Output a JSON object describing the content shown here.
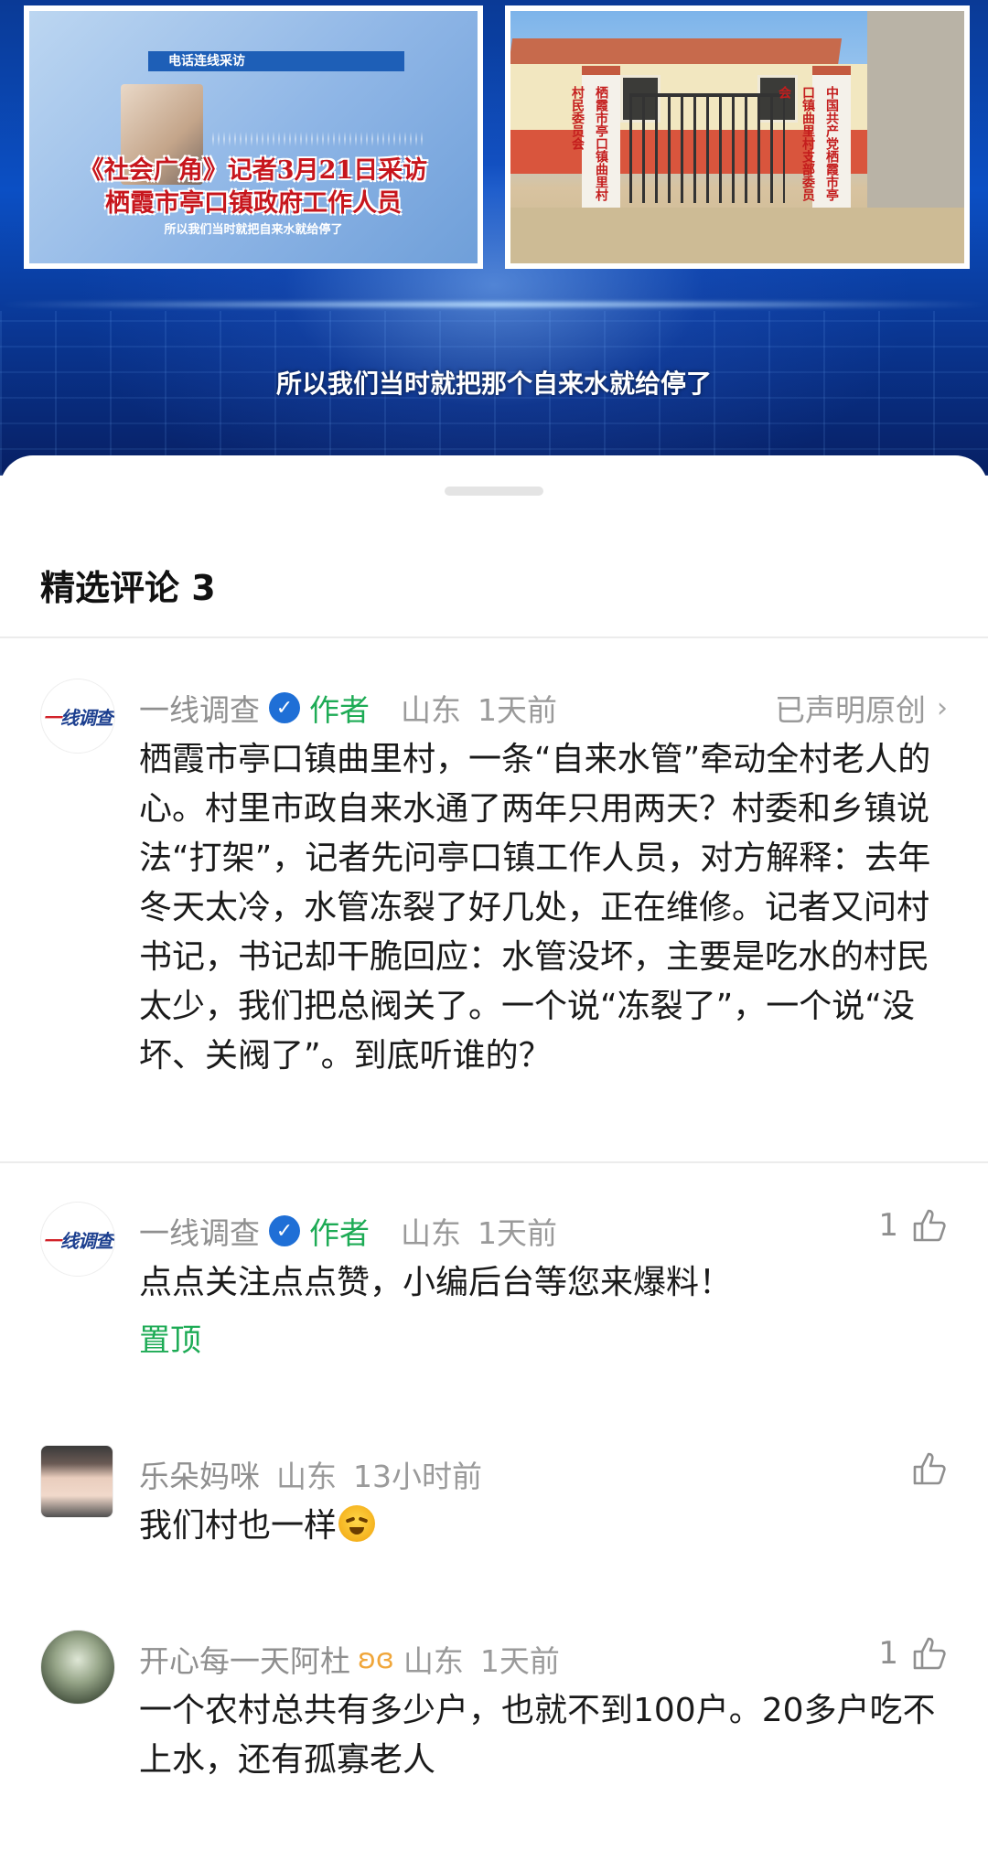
{
  "video": {
    "left_panel": {
      "tag": "电话连线采访",
      "headline_line1": "《社会广角》记者3月21日采访",
      "headline_line2": "栖霞市亭口镇政府工作人员",
      "caption": "所以我们当时就把自来水就给停了"
    },
    "right_panel": {
      "sign_left": "栖霞市亭口镇曲里村村民委员会",
      "sign_right": "中国共产党栖霞市亭口镇曲里村支部委员会"
    },
    "subtitle": "所以我们当时就把那个自来水就给停了"
  },
  "comments_sheet": {
    "title": "精选评论 3",
    "comments": [
      {
        "user": "一线调查",
        "avatar_logo": "一线调查",
        "verified_icon": "verified-check-icon",
        "author_tag": "作者",
        "location": "山东",
        "time": "1天前",
        "right_action": "已声明原创",
        "text": "栖霞市亭口镇曲里村，一条“自来水管”牵动全村老人的心。村里市政自来水通了两年只用两天？村委和乡镇说法“打架”，记者先问亭口镇工作人员，对方解释：去年冬天太冷，水管冻裂了好几处，正在维修。记者又问村书记，书记却干脆回应：水管没坏，主要是吃水的村民太少，我们把总阀关了。一个说“冻裂了”，一个说“没坏、关阀了”。到底听谁的？"
      },
      {
        "user": "一线调查",
        "avatar_logo": "一线调查",
        "verified_icon": "verified-check-icon",
        "author_tag": "作者",
        "location": "山东",
        "time": "1天前",
        "likes": "1",
        "text": "点点关注点点赞，小编后台等您来爆料！",
        "pinned": "置顶"
      },
      {
        "user": "乐朵妈咪",
        "location": "山东",
        "time": "13小时前",
        "likes": "",
        "text": "我们村也一样",
        "emoji": "loudly-crying-face-emoji"
      },
      {
        "user": "开心每一天阿杜",
        "badge_icon": "butterfly-badge-icon",
        "location": "山东",
        "time": "1天前",
        "likes": "1",
        "text": "一个农村总共有多少户，也就不到100户。20多户吃不上水，还有孤寡老人"
      }
    ]
  },
  "colors": {
    "author_green": "#1dab55",
    "verified_blue": "#1f6fd6",
    "meta_gray": "#9a9a9a",
    "video_blue": "#0b4fc4"
  }
}
